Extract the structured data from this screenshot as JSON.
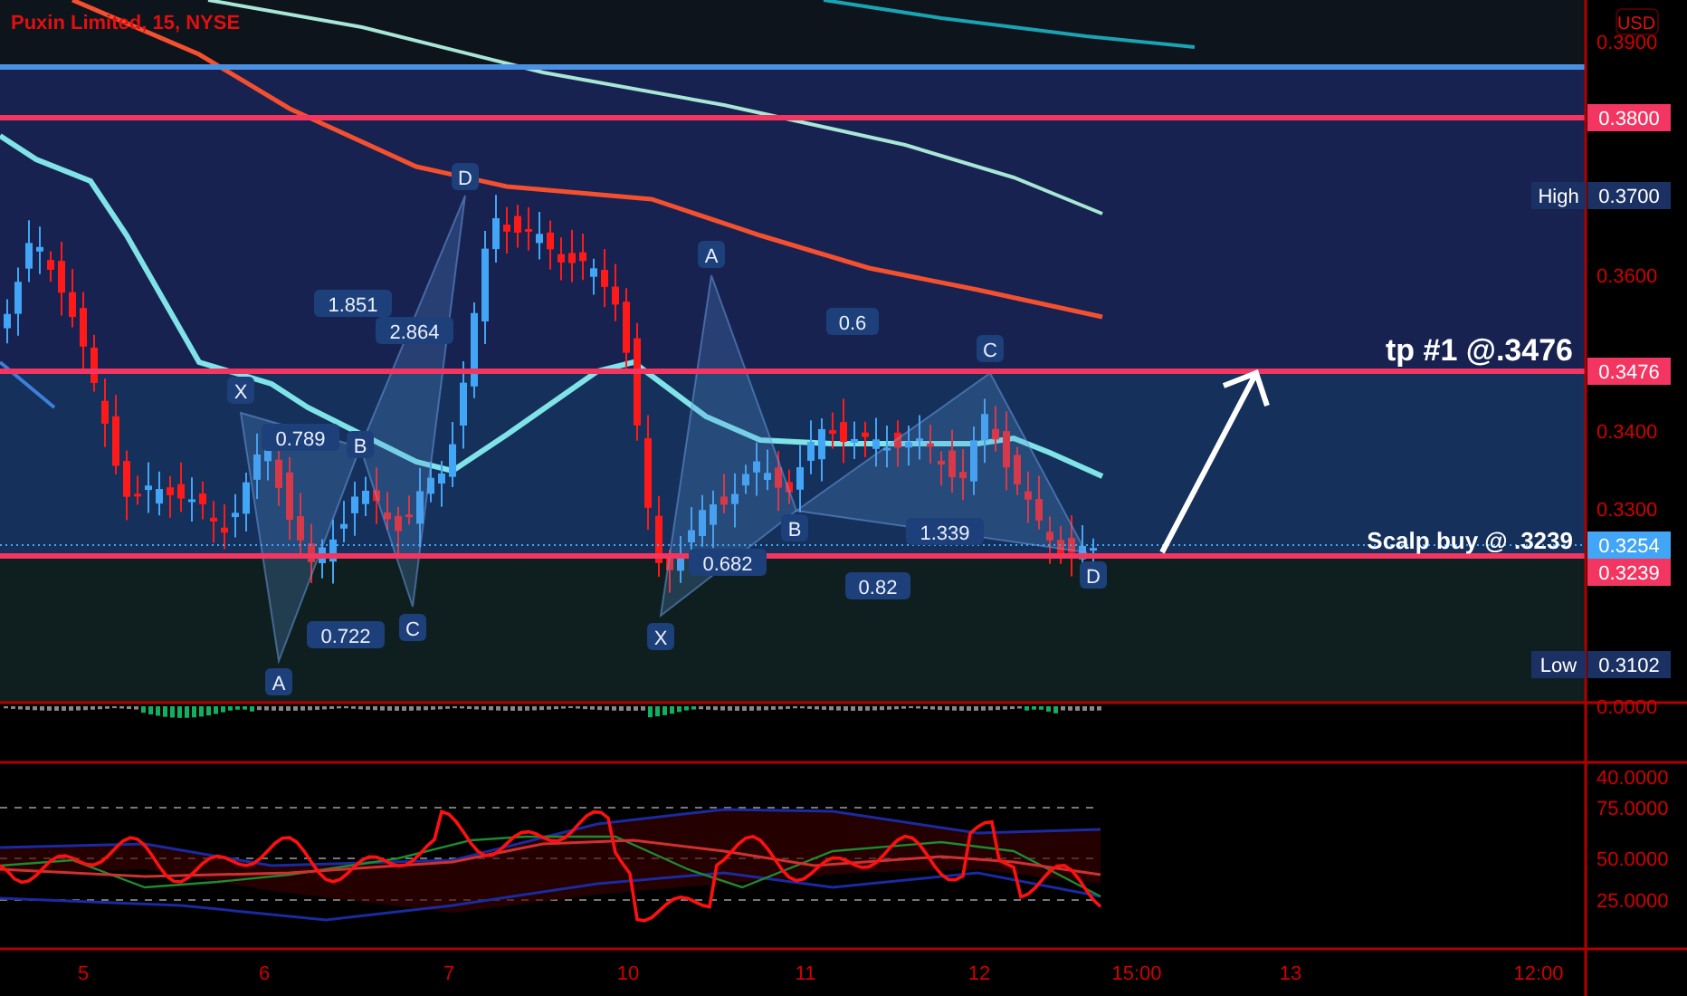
{
  "chart": {
    "title": "Puxin Limited, 15, NYSE",
    "currency": "USD",
    "price_ticks": [
      "0.3900",
      "0.3600",
      "0.3400",
      "0.3300"
    ],
    "price_markers": [
      {
        "value": "0.3800",
        "color": "#f23661"
      },
      {
        "label": "High",
        "value": "0.3700",
        "color": "#1b3163"
      },
      {
        "value": "0.3476",
        "color": "#f23661"
      },
      {
        "value": "0.3254",
        "color": "#42a5f5"
      },
      {
        "value": "0.3239",
        "color": "#f23661"
      },
      {
        "label": "Low",
        "value": "0.3102",
        "color": "#1b3163"
      }
    ],
    "annotations": [
      "tp #1 @.3476",
      "Scalp buy @ .3239"
    ],
    "patterns": [
      {
        "labels": [
          "D",
          "1.851",
          "2.864",
          "X",
          "0.789",
          "B",
          "0.722",
          "C",
          "A"
        ]
      },
      {
        "labels": [
          "A",
          "0.6",
          "C",
          "B",
          "1.339",
          "0.682",
          "0.82",
          "X",
          "D"
        ]
      }
    ],
    "macd_ticks": [
      "0.0000"
    ],
    "rsi_ticks": [
      "40.0000",
      "75.0000",
      "50.0000",
      "25.0000"
    ],
    "time_ticks": [
      "5",
      "6",
      "7",
      "10",
      "11",
      "12",
      "15:00",
      "13",
      "12:00"
    ]
  }
}
